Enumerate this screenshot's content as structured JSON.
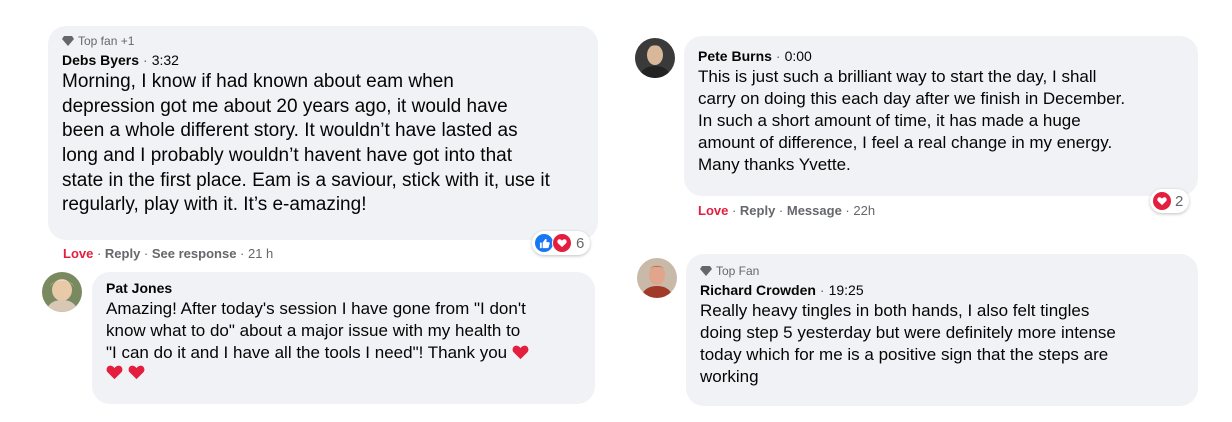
{
  "colors": {
    "bubble_bg": "#f0f2f5",
    "love_red": "#e41e3f",
    "like_blue": "#1877f2",
    "meta_gray": "#65676b"
  },
  "comments": [
    {
      "badge": "Top fan +1",
      "badge_icon": "diamond-icon",
      "name": "Debs Byers",
      "time": "3:32",
      "text_lines": [
        "Morning, I know if had known about eam when",
        "depression got me about 20 years ago, it would have",
        "been a whole different story. It wouldn’t have lasted as",
        "long and I probably wouldn’t havent have got into that",
        "state in the first place. Eam is a saviour, stick with it, use it",
        "regularly, play with it. It’s e-amazing!"
      ],
      "actions": {
        "love": "Love",
        "reply": "Reply",
        "see_response": "See response",
        "age": "21 h"
      },
      "reactions": {
        "icons": [
          "like-icon",
          "love-icon"
        ],
        "count": "6"
      }
    },
    {
      "name": "Pat Jones",
      "text_lines": [
        "Amazing! After today's session I have gone from \"I don't",
        "know what to do\" about a major issue with my health to",
        "\"I can do it and I have all the tools I need\"! Thank you",
        ""
      ],
      "emoji": "heart-icon"
    },
    {
      "name": "Pete Burns",
      "time": "0:00",
      "text_lines": [
        "This is just such a brilliant way to start the day, I shall",
        "carry on doing this each day after we finish in December.",
        "In such a short amount of time, it has made a huge",
        "amount of difference, I feel a real change in my energy.",
        "Many thanks Yvette."
      ],
      "actions": {
        "love": "Love",
        "reply": "Reply",
        "message": "Message",
        "age": "22h"
      },
      "reactions": {
        "icons": [
          "love-icon"
        ],
        "count": "2"
      }
    },
    {
      "badge": "Top Fan",
      "badge_icon": "diamond-icon",
      "name": "Richard Crowden",
      "time": "19:25",
      "text_lines": [
        "Really heavy tingles in both hands, I also felt tingles",
        "doing step 5 yesterday but were definitely more intense",
        "today which for me is a positive sign that the steps are",
        "working"
      ]
    }
  ]
}
